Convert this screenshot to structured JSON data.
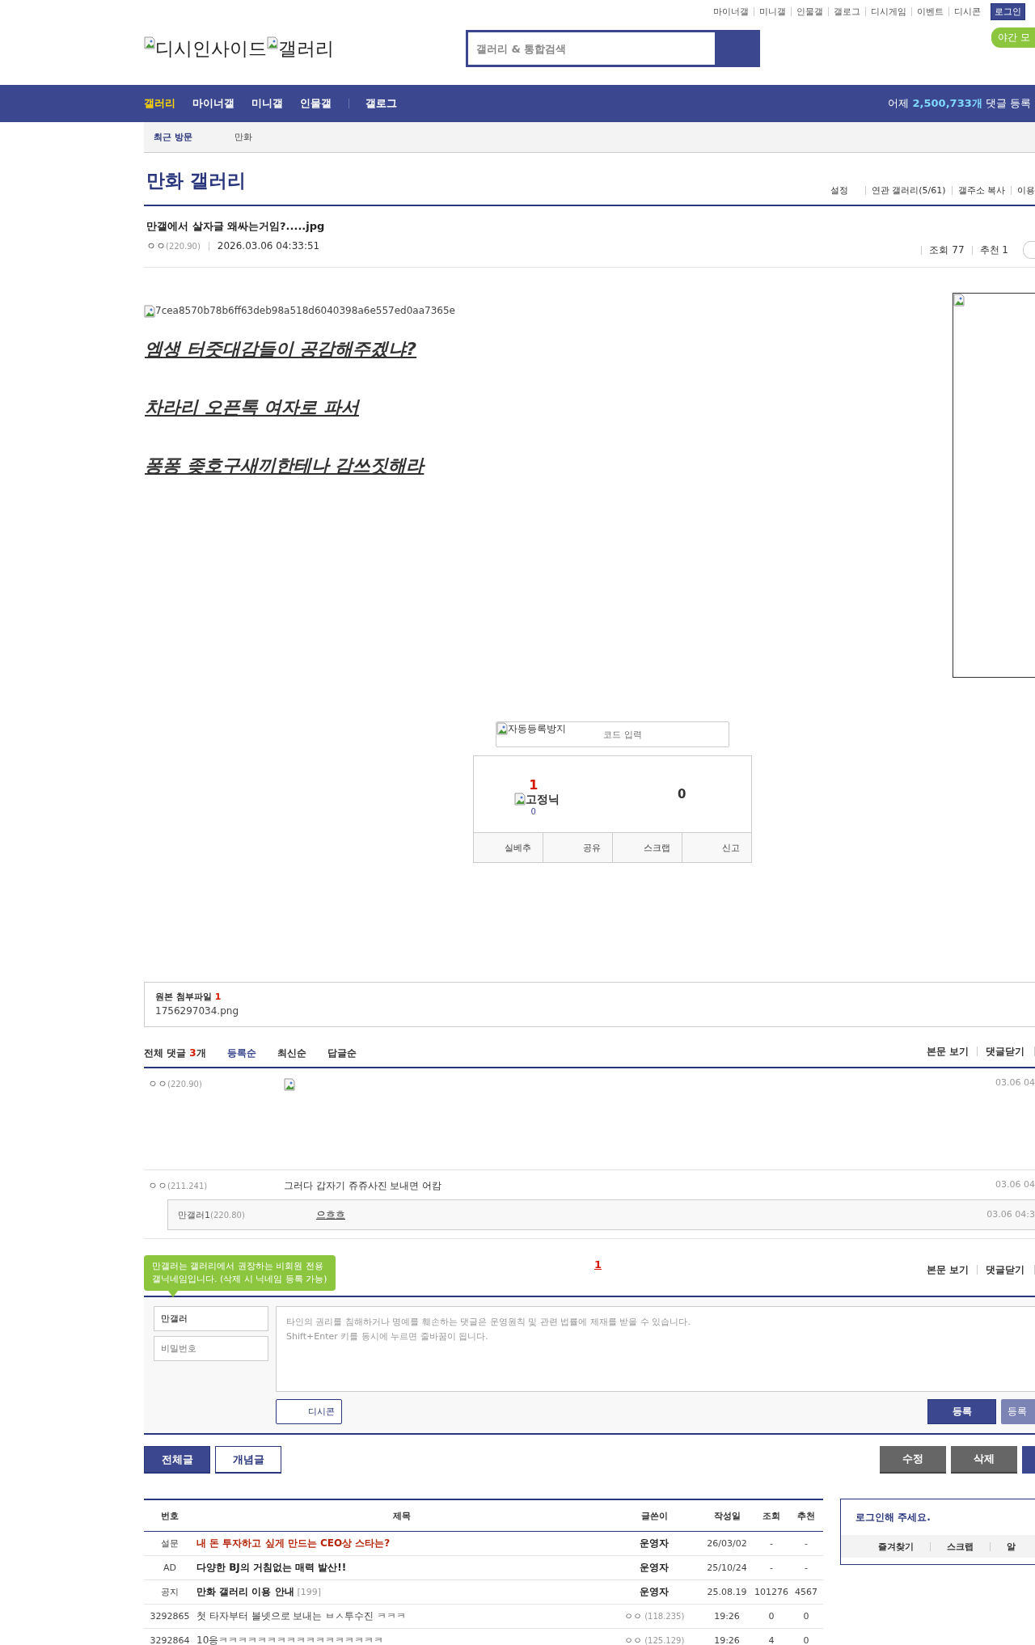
{
  "top_links": [
    "마이너갤",
    "미니갤",
    "인물갤",
    "갤로그",
    "디시게임",
    "이벤트",
    "디시콘"
  ],
  "login_button": "로그인",
  "night_mode_button": "야간 모",
  "logo": {
    "site_alt": "디시인사이드",
    "gallery_alt": "갤러리"
  },
  "search": {
    "placeholder": "갤러리 & 통합검색"
  },
  "nav": {
    "items": [
      {
        "label": "갤러리",
        "selected": true
      },
      {
        "label": "마이너갤",
        "selected": false
      },
      {
        "label": "미니갤",
        "selected": false
      },
      {
        "label": "인물갤",
        "selected": false
      },
      {
        "label": "갤로그",
        "selected": false
      }
    ],
    "stat_prefix": "어제",
    "stat_count": "2,500,733개",
    "stat_suffix": "댓글 등록"
  },
  "recent": {
    "label": "최근 방문",
    "items": [
      "만화"
    ]
  },
  "gallery": {
    "title": "만화 갤러리",
    "links": [
      "설정",
      "연관 갤러리(5/61)",
      "갤주소 복사",
      "이용"
    ]
  },
  "post": {
    "title": "만갤에서 살자글 왜싸는거임?.....jpg",
    "author": "ㅇㅇ",
    "ip": "(220.90)",
    "date": "2026.03.06 04:33:51",
    "views": "조회 77",
    "recommend": "추천 1",
    "image_alt": "7cea8570b78b6ff63deb98a518d6040398a6e557ed0aa7365e",
    "lines": [
      "엠생 터줏대감들이 공감해주겠냐?",
      "차라리 오픈톡 여자로 파서",
      "퐁퐁 좆호구새끼한테나 감쓰짓해라"
    ]
  },
  "captcha": {
    "image_alt": "자동등록방지",
    "placeholder": "코드 입력"
  },
  "vote": {
    "up_count": "1",
    "fixed_nick_alt": "고정닉",
    "fixed_count": "0",
    "down_count": "0",
    "actions": [
      "실베추",
      "공유",
      "스크랩",
      "신고"
    ]
  },
  "attachment": {
    "label": "원본 첨부파일",
    "count": "1",
    "file": "1756297034.png"
  },
  "comments": {
    "label": "전체 댓글",
    "count": "3",
    "unit": "개",
    "sorts": [
      {
        "label": "등록순",
        "selected": true
      },
      {
        "label": "최신순",
        "selected": false
      },
      {
        "label": "답글순",
        "selected": false
      }
    ],
    "links": [
      "본문 보기",
      "댓글닫기"
    ],
    "items": [
      {
        "kind": "image",
        "author": "ㅇㅇ",
        "ip": "(220.90)",
        "time": "03.06 04"
      },
      {
        "kind": "text",
        "author": "ㅇㅇ",
        "ip": "(211.241)",
        "text": "그러다 갑자기 쥬쥬사진 보내면 어캄",
        "time": "03.06 04",
        "replies": [
          {
            "author": "만갤러1",
            "ip": "(220.80)",
            "text": "으흐흐",
            "time": "03.06 04:3"
          }
        ]
      }
    ],
    "pages": [
      {
        "label": "1",
        "selected": true
      }
    ],
    "bottom_links": [
      "본문 보기",
      "댓글닫기"
    ]
  },
  "comment_form": {
    "tooltip": "만갤러는 갤러리에서 권장하는 비회원 전용\n갤닉네임입니다. (삭제 시 닉네임 등록 가능)",
    "nickname": "만갤러",
    "password_placeholder": "비밀번호",
    "placeholder": "타인의 권리를 침해하거나 명예를 훼손하는 댓글은 운영원칙 및 관련 법률에 제재를 받을 수 있습니다.\nShift+Enter 키를 동시에 누르면 줄바꿈이 됩니다.",
    "dccon_button": "디시콘",
    "submit_buttons": [
      "등록",
      "등록"
    ]
  },
  "post_buttons": {
    "left": [
      {
        "label": "전체글",
        "selected": true
      },
      {
        "label": "개념글",
        "selected": false
      }
    ],
    "right": [
      "수정",
      "삭제"
    ]
  },
  "list": {
    "columns": [
      "번호",
      "제목",
      "글쓴이",
      "작성일",
      "조회",
      "추천"
    ],
    "rows": [
      {
        "kind": "survey",
        "number": "설문",
        "title": "내 돈 투자하고 싶게 만드는 CEO상 스타는?",
        "writer": "운영자",
        "date": "26/03/02",
        "views": "-",
        "recommend": "-"
      },
      {
        "kind": "ad",
        "number": "AD",
        "title": "다양한 BJ의 거침없는 매력 발산!!",
        "writer": "운영자",
        "date": "25/10/24",
        "views": "-",
        "recommend": "-"
      },
      {
        "kind": "notice",
        "number": "공지",
        "title": "만화 갤러리 이용 안내",
        "reply_count": "[199]",
        "writer": "운영자",
        "date": "25.08.19",
        "views": "101276",
        "recommend": "4567"
      },
      {
        "kind": "post",
        "number": "3292865",
        "title": "첫 타자부터 볼넷으로 보내는 ㅂㅅ투수진 ㅋㅋㅋ",
        "writer": "ㅇㅇ",
        "ip": "(118.235)",
        "date": "19:26",
        "views": "0",
        "recommend": "0"
      },
      {
        "kind": "post",
        "number": "3292864",
        "title": "10응ㅋㅋㅋㅋㅋㅋㅋㅋㅋㅋㅋㅋㅋㅋㅋㅋㅋ",
        "writer": "ㅇㅇ",
        "ip": "(125.129)",
        "date": "19:26",
        "views": "4",
        "recommend": "0"
      }
    ]
  },
  "login_box": {
    "message": "로그인해 주세요.",
    "links": [
      "즐겨찾기",
      "스크랩",
      "알"
    ]
  }
}
